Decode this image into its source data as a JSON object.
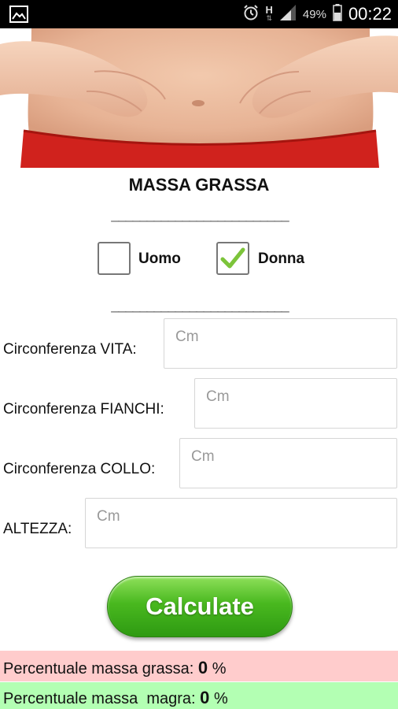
{
  "status": {
    "battery": "49%",
    "time": "00:22",
    "network": "H"
  },
  "title": "MASSA GRASSA",
  "separator": "_________________________",
  "gender": {
    "male_label": "Uomo",
    "male_checked": false,
    "female_label": "Donna",
    "female_checked": true
  },
  "fields": [
    {
      "label": "Circonferenza VITA:",
      "placeholder": "Cm",
      "value": ""
    },
    {
      "label": "Circonferenza FIANCHI:",
      "placeholder": "Cm",
      "value": ""
    },
    {
      "label": "Circonferenza COLLO:",
      "placeholder": "Cm",
      "value": ""
    },
    {
      "label": "ALTEZZA:",
      "placeholder": "Cm",
      "value": ""
    }
  ],
  "button": {
    "label": "Calculate"
  },
  "results": {
    "fat_label": "Percentuale massa grassa:",
    "fat_value": "0",
    "fat_unit": "%",
    "fat_bg": "#ffcccc",
    "lean_label": "Percentuale massa  magra:",
    "lean_value": "0",
    "lean_unit": "%",
    "lean_bg": "#b3ffb3"
  },
  "icons": {
    "notification": "image-notification-icon",
    "alarm": "alarm-icon",
    "network": "network-h-icon",
    "signal": "signal-icon",
    "battery": "battery-icon"
  }
}
